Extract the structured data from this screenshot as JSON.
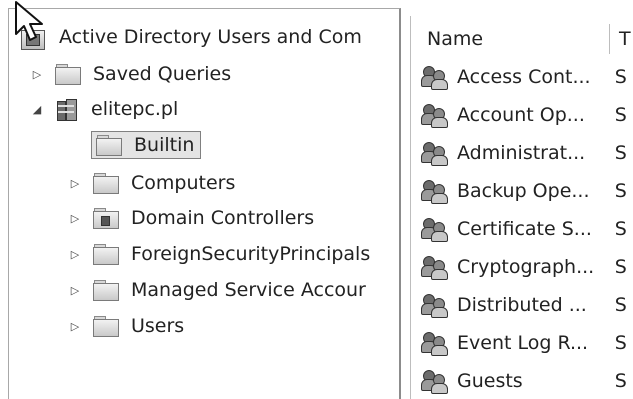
{
  "tree": {
    "root_label": "Active Directory Users and Com",
    "items": [
      {
        "label": "Saved Queries"
      },
      {
        "label": "elitepc.pl"
      },
      {
        "label": "Builtin"
      },
      {
        "label": "Computers"
      },
      {
        "label": "Domain Controllers"
      },
      {
        "label": "ForeignSecurityPrincipals"
      },
      {
        "label": "Managed Service Accour"
      },
      {
        "label": "Users"
      }
    ],
    "expander_collapsed": "▷",
    "expander_expanded": "◢"
  },
  "list": {
    "columns": {
      "name": "Name",
      "type": "T"
    },
    "rows": [
      {
        "name": "Access Cont...",
        "type": "S"
      },
      {
        "name": "Account Op...",
        "type": "S"
      },
      {
        "name": "Administrat...",
        "type": "S"
      },
      {
        "name": "Backup Ope...",
        "type": "S"
      },
      {
        "name": "Certificate S...",
        "type": "S"
      },
      {
        "name": "Cryptograph...",
        "type": "S"
      },
      {
        "name": "Distributed ...",
        "type": "S"
      },
      {
        "name": "Event Log R...",
        "type": "S"
      },
      {
        "name": "Guests",
        "type": "S"
      }
    ]
  },
  "icons": {
    "root": "ad-snapin-icon",
    "domain": "domain-icon",
    "folder": "folder-icon",
    "ou": "organizational-unit-icon",
    "group": "security-group-icon",
    "cursor": "mouse-pointer-icon"
  }
}
